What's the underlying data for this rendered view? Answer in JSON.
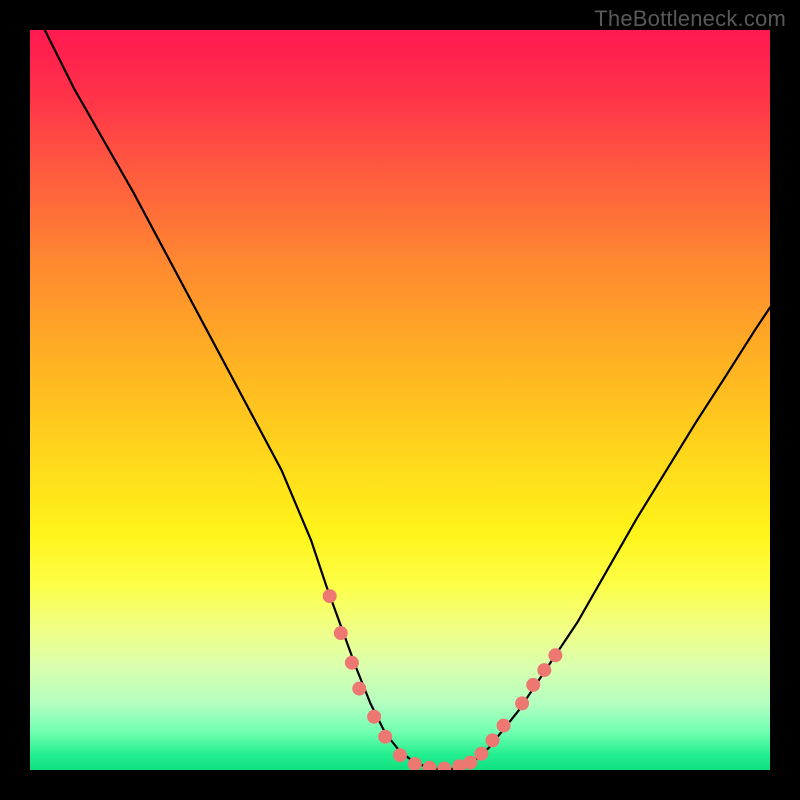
{
  "watermark_text": "TheBottleneck.com",
  "chart_data": {
    "type": "line",
    "title": "",
    "xlabel": "",
    "ylabel": "",
    "xlim": [
      0,
      100
    ],
    "ylim": [
      0,
      100
    ],
    "series": [
      {
        "name": "curve",
        "x": [
          2,
          6,
          10,
          14,
          18,
          22,
          26,
          30,
          34,
          38,
          40,
          42,
          44,
          46,
          48,
          50,
          52,
          54,
          56,
          58,
          60,
          62,
          66,
          70,
          74,
          78,
          82,
          86,
          90,
          94,
          98,
          100
        ],
        "y": [
          100,
          92,
          85,
          78,
          70.5,
          63,
          55.5,
          48,
          40.5,
          31,
          25,
          19.5,
          14,
          9,
          5,
          2.5,
          1,
          0.3,
          0,
          0.3,
          1.2,
          3,
          8,
          14,
          20,
          27,
          34,
          40.5,
          47,
          53.2,
          59.5,
          62.5
        ]
      }
    ],
    "markers": [
      {
        "x": 40.5,
        "y": 23.5
      },
      {
        "x": 42.0,
        "y": 18.5
      },
      {
        "x": 43.5,
        "y": 14.5
      },
      {
        "x": 44.5,
        "y": 11.0
      },
      {
        "x": 46.5,
        "y": 7.2
      },
      {
        "x": 48.0,
        "y": 4.5
      },
      {
        "x": 50.0,
        "y": 2.0
      },
      {
        "x": 52.0,
        "y": 0.8
      },
      {
        "x": 54.0,
        "y": 0.3
      },
      {
        "x": 56.0,
        "y": 0.2
      },
      {
        "x": 58.0,
        "y": 0.5
      },
      {
        "x": 59.5,
        "y": 1.0
      },
      {
        "x": 61.0,
        "y": 2.2
      },
      {
        "x": 62.5,
        "y": 4.0
      },
      {
        "x": 64.0,
        "y": 6.0
      },
      {
        "x": 66.5,
        "y": 9.0
      },
      {
        "x": 68.0,
        "y": 11.5
      },
      {
        "x": 69.5,
        "y": 13.5
      },
      {
        "x": 71.0,
        "y": 15.5
      }
    ],
    "marker_color": "#ed7871",
    "curve_color": "#000000"
  }
}
